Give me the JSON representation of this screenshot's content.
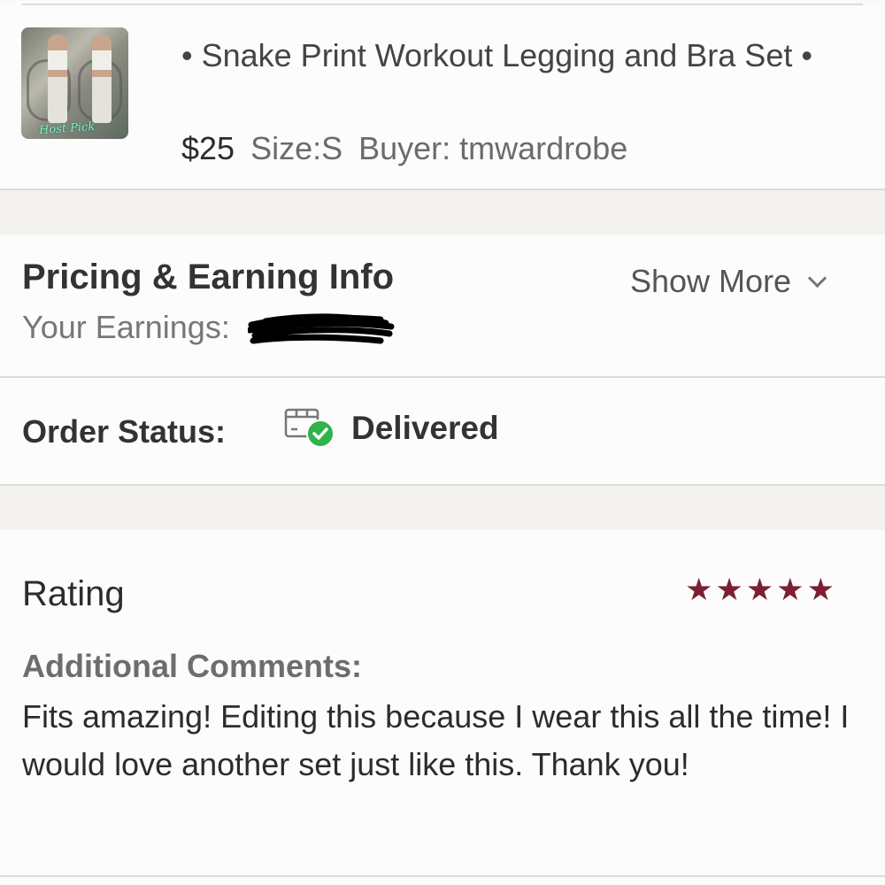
{
  "product": {
    "thumbnail_text": "Host Pick",
    "title": "• Snake Print Workout Legging and Bra Set •",
    "price": "$25",
    "size": "Size:S",
    "buyer": "Buyer: tmwardrobe"
  },
  "pricing": {
    "title": "Pricing & Earning Info",
    "show_more": "Show More",
    "earnings_label": "Your Earnings:"
  },
  "order_status": {
    "label": "Order Status:",
    "value": "Delivered",
    "icon": "delivered-box-icon"
  },
  "rating": {
    "title": "Rating",
    "stars": 5,
    "star_color": "#7c1f33",
    "additional_comments_label": "Additional Comments:",
    "comment": "Fits amazing! Editing this because I wear this all the time! I would love another set just like this. Thank you!"
  },
  "colors": {
    "background": "#fafaf9",
    "section_gap": "#f3f2ee",
    "delivered_check": "#2fb34a"
  }
}
